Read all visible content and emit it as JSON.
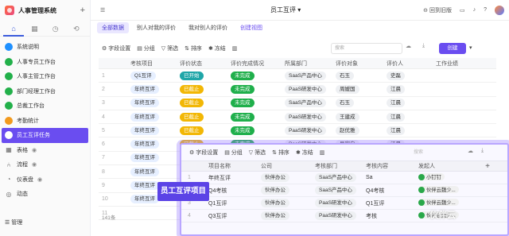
{
  "sidebar": {
    "app_title": "人事管理系统",
    "items": [
      {
        "label": "系统说明",
        "color": "#1e90ff"
      },
      {
        "label": "人事专员工作台",
        "color": "#22b04a"
      },
      {
        "label": "人事主管工作台",
        "color": "#22b04a"
      },
      {
        "label": "部门经理工作台",
        "color": "#22b04a"
      },
      {
        "label": "总裁工作台",
        "color": "#22b04a"
      },
      {
        "label": "考勤统计",
        "color": "#f29a1e"
      },
      {
        "label": "员工互评任务",
        "color": "#ffffff"
      }
    ],
    "sections": [
      {
        "label": "表格"
      },
      {
        "label": "流程"
      },
      {
        "label": "仪表盘"
      },
      {
        "label": "动态"
      }
    ],
    "manage": "管理"
  },
  "topbar": {
    "title": "员工互评",
    "reset": "回到旧版"
  },
  "view_tabs": [
    "全部数据",
    "别人对我的评价",
    "我对别人的评价",
    "创建视图"
  ],
  "toolbar": {
    "fields": "字段设置",
    "group": "分组",
    "filter": "筛选",
    "sort": "排序",
    "freeze": "冻结",
    "search": "搜索",
    "create": "创建"
  },
  "table": {
    "headers": [
      "考核项目",
      "评价状态",
      "评价完成情况",
      "所属部门",
      "评价对象",
      "评价人",
      "工作业绩"
    ],
    "rows": [
      {
        "n": "1",
        "project": "Q1互评",
        "status": "已开始",
        "status_color": "teal",
        "done": "未完成",
        "dept": "SaaS产品中心",
        "target": "石玉",
        "rater": "史磊"
      },
      {
        "n": "2",
        "project": "年终互评",
        "status": "已截止",
        "status_color": "yellow",
        "done": "未完成",
        "dept": "PaaS研发中心",
        "target": "周嫒国",
        "rater": "江晨"
      },
      {
        "n": "3",
        "project": "年终互评",
        "status": "已截止",
        "status_color": "yellow",
        "done": "未完成",
        "dept": "SaaS产品中心",
        "target": "石玉",
        "rater": "江晨"
      },
      {
        "n": "4",
        "project": "年终互评",
        "status": "已截止",
        "status_color": "yellow",
        "done": "未完成",
        "dept": "PaaS研发中心",
        "target": "王建成",
        "rater": "江晨"
      },
      {
        "n": "5",
        "project": "年终互评",
        "status": "已截止",
        "status_color": "yellow",
        "done": "未完成",
        "dept": "PaaS研发中心",
        "target": "赵优雅",
        "rater": "江晨"
      },
      {
        "n": "6",
        "project": "年终互评",
        "status": "已截止",
        "status_color": "yellow",
        "done": "未完成",
        "dept": "PaaS研发中心",
        "target": "吴宗白",
        "rater": "江晨"
      },
      {
        "n": "7",
        "project": "年终互评",
        "status": "",
        "status_color": "",
        "done": "",
        "dept": "",
        "target": "",
        "rater": ""
      },
      {
        "n": "8",
        "project": "年终互评",
        "status": "",
        "status_color": "",
        "done": "",
        "dept": "",
        "target": "",
        "rater": ""
      },
      {
        "n": "9",
        "project": "年终互评",
        "status": "",
        "status_color": "",
        "done": "",
        "dept": "",
        "target": "",
        "rater": ""
      },
      {
        "n": "10",
        "project": "年终互评",
        "status": "",
        "status_color": "",
        "done": "",
        "dept": "",
        "target": "",
        "rater": ""
      },
      {
        "n": "11",
        "project": "",
        "status": "",
        "status_color": "",
        "done": "",
        "dept": "",
        "target": "",
        "rater": ""
      }
    ],
    "count": "141条"
  },
  "popup": {
    "toolbar": {
      "fields": "字段设置",
      "group": "分组",
      "filter": "筛选",
      "sort": "排序",
      "freeze": "冻结",
      "search": "搜索"
    },
    "headers": [
      "项目名称",
      "公司",
      "考核部门",
      "考核内容",
      "发起人"
    ],
    "rows": [
      {
        "n": "1",
        "name": "年终互评",
        "company": "伙伴办公",
        "dept": "SaaS产品中心",
        "content": "Sa",
        "initiator": "小钉钉"
      },
      {
        "n": "2",
        "name": "Q4考核",
        "company": "伙伴办公",
        "dept": "SaaS产品中心",
        "content": "Q4考核",
        "initiator": "伙伴云魏少..."
      },
      {
        "n": "3",
        "name": "Q1互评",
        "company": "伙伴办公",
        "dept": "PaaS研发中心",
        "content": "Q1互评",
        "initiator": "伙伴云魏少..."
      },
      {
        "n": "4",
        "name": "Q3互评",
        "company": "伙伴办公",
        "dept": "PaaS研发中心",
        "content": "考核",
        "initiator": "伙伴云魏少..."
      }
    ]
  },
  "overlay_label": "员工互评项目",
  "watermark": "伙伴云"
}
